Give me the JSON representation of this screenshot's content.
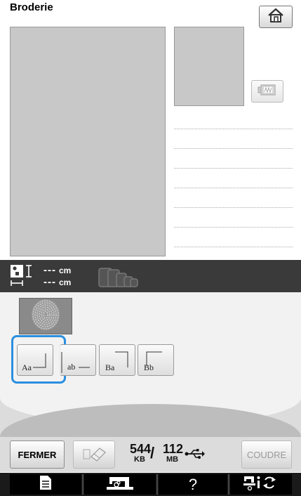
{
  "header": {
    "title": "Broderie"
  },
  "info": {
    "width_value": "---",
    "height_value": "---",
    "unit": "cm"
  },
  "layouts": [
    {
      "label": "Aa"
    },
    {
      "label": "ab"
    },
    {
      "label": "Ba"
    },
    {
      "label": "Bb"
    }
  ],
  "toolbar": {
    "close_label": "FERMER",
    "memory_kb": "544",
    "memory_kb_unit": "KB",
    "memory_sep": "/",
    "memory_mb": "112",
    "memory_mb_unit": "MB",
    "sew_label": "COUDRE"
  },
  "nav": {
    "help_label": "?"
  },
  "colors": {
    "selection": "#2b8fe0",
    "infobar": "#3a3a3a",
    "preview": "#c8c8c8"
  }
}
